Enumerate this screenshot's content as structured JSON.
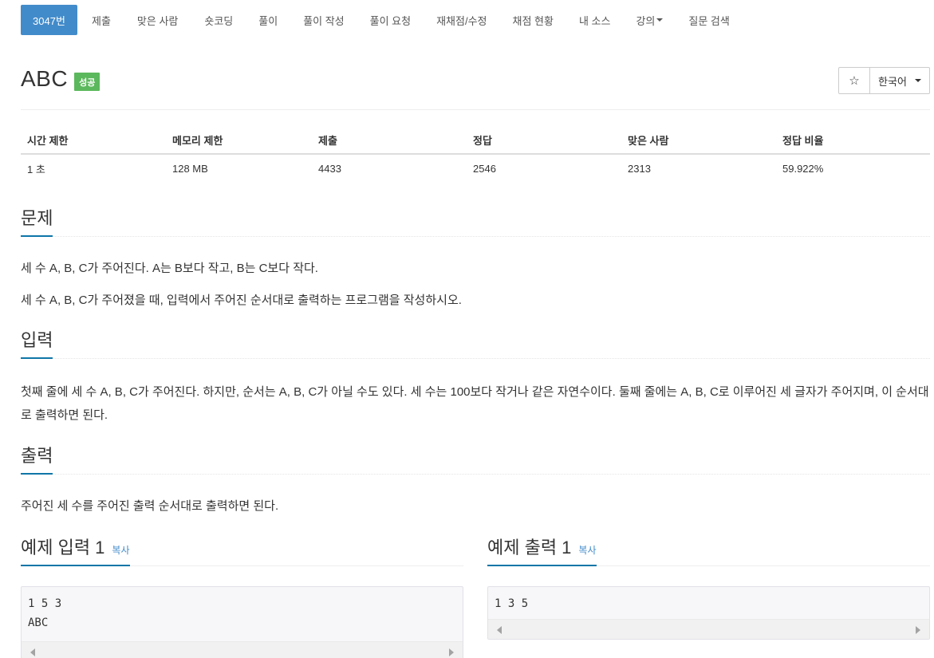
{
  "nav": {
    "tabs": [
      {
        "label": "3047번",
        "active": true
      },
      {
        "label": "제출"
      },
      {
        "label": "맞은 사람"
      },
      {
        "label": "숏코딩"
      },
      {
        "label": "풀이"
      },
      {
        "label": "풀이 작성"
      },
      {
        "label": "풀이 요청"
      },
      {
        "label": "재채점/수정"
      },
      {
        "label": "채점 현황"
      },
      {
        "label": "내 소스"
      },
      {
        "label": "강의"
      },
      {
        "label": "질문 검색"
      }
    ]
  },
  "problem": {
    "title": "ABC",
    "badge": "성공",
    "star": "☆",
    "language": "한국어"
  },
  "info": {
    "headers": [
      "시간 제한",
      "메모리 제한",
      "제출",
      "정답",
      "맞은 사람",
      "정답 비율"
    ],
    "values": [
      "1 초",
      "128 MB",
      "4433",
      "2546",
      "2313",
      "59.922%"
    ]
  },
  "sections": {
    "problem": {
      "heading": "문제",
      "lines": [
        "세 수 A, B, C가 주어진다. A는 B보다 작고, B는 C보다 작다.",
        "세 수 A, B, C가 주어졌을 때, 입력에서 주어진 순서대로 출력하는 프로그램을 작성하시오."
      ]
    },
    "input": {
      "heading": "입력",
      "text": "첫째 줄에 세 수 A, B, C가 주어진다. 하지만, 순서는 A, B, C가 아닐 수도 있다. 세 수는 100보다 작거나 같은 자연수이다. 둘째 줄에는 A, B, C로 이루어진 세 글자가 주어지며, 이 순서대로 출력하면 된다."
    },
    "output": {
      "heading": "출력",
      "text": "주어진 세 수를 주어진 출력 순서대로 출력하면 된다."
    }
  },
  "samples": {
    "input": {
      "heading": "예제 입력 1",
      "copy": "복사",
      "content": "1 5 3\nABC"
    },
    "output": {
      "heading": "예제 출력 1",
      "copy": "복사",
      "content": "1 3 5"
    }
  }
}
